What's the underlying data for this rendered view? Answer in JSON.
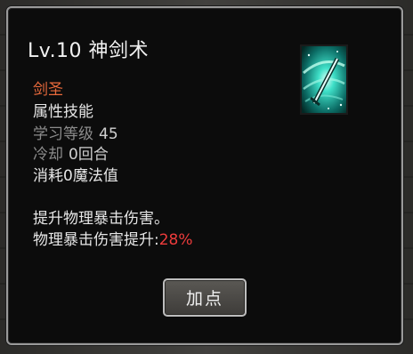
{
  "tooltip": {
    "title": "Lv.10 神剑术",
    "skill_icon": "teal-sword-slash-icon",
    "class_name": "剑圣",
    "skill_type": "属性技能",
    "learn_level_label": "学习等级",
    "learn_level_value": "45",
    "cooldown_label": "冷却",
    "cooldown_value": "0回合",
    "cost": "消耗0魔法值",
    "description_line1": "提升物理暴击伤害。",
    "description_line2_label": "物理暴击伤害提升:",
    "description_line2_value": "28%",
    "button_label": "加点"
  },
  "colors": {
    "class_name": "#e96a3c",
    "highlight_value": "#ee3c3c",
    "icon_glow": "#3fe0c8"
  }
}
